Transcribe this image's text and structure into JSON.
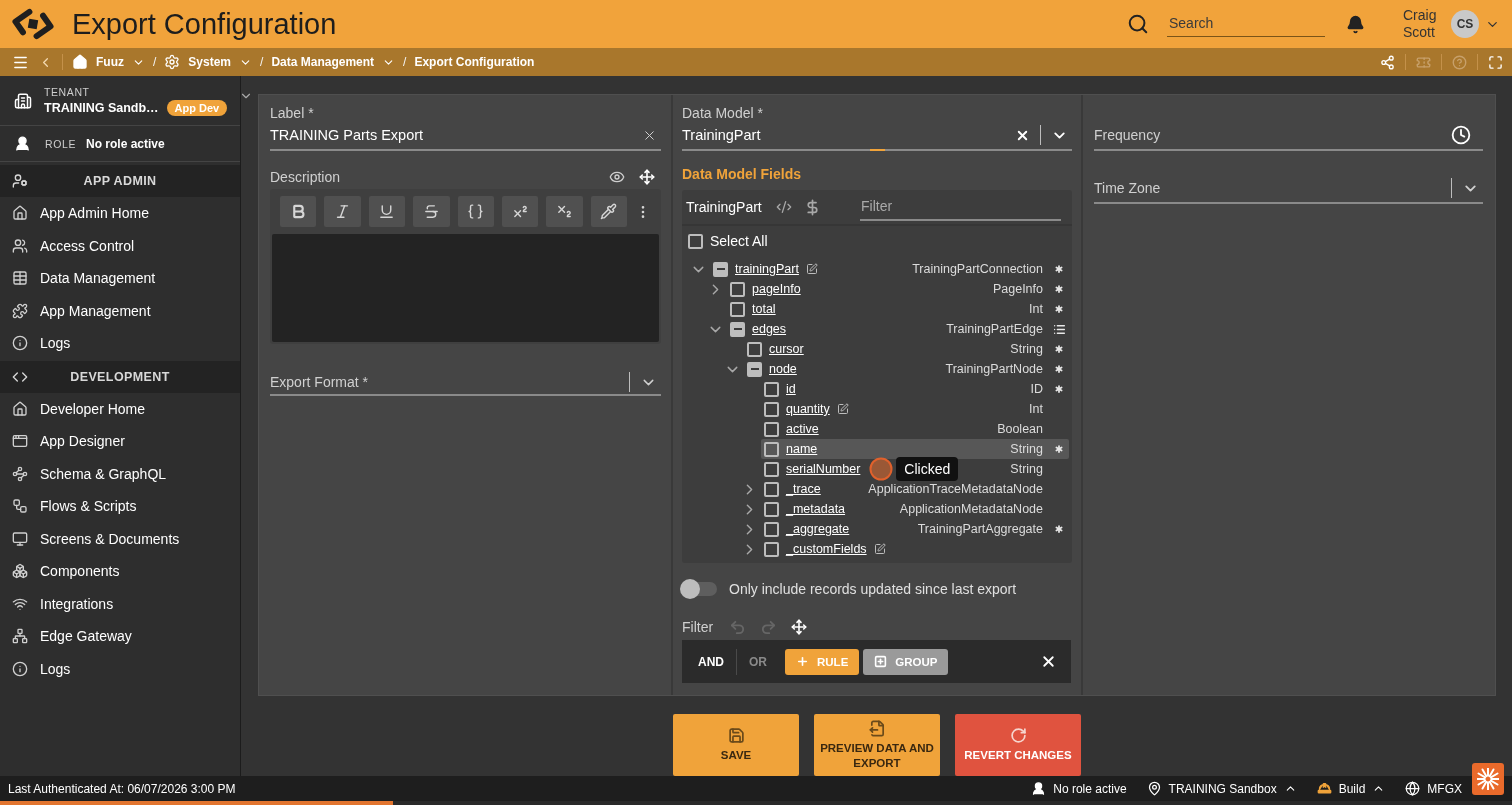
{
  "header": {
    "title": "Export Configuration",
    "search": {
      "placeholder": "Search"
    },
    "user": {
      "name": "Craig Scott",
      "initials": "CS"
    }
  },
  "breadcrumbs": [
    {
      "kind": "crumb",
      "label": "Fuuz",
      "dropdown": true
    },
    {
      "kind": "separator",
      "label": "/"
    },
    {
      "kind": "crumb",
      "label": "System",
      "dropdown": true
    },
    {
      "kind": "separator",
      "label": "/"
    },
    {
      "kind": "crumb",
      "label": "Data Management",
      "dropdown": true
    },
    {
      "kind": "separator",
      "label": "/"
    },
    {
      "kind": "crumb",
      "label": "Export Configuration",
      "dropdown": false
    }
  ],
  "page_actions": [
    {
      "disabled": false
    },
    {
      "disabled": true
    },
    {
      "disabled": true
    },
    {
      "disabled": false
    }
  ],
  "sidebar": {
    "tenant": {
      "label": "TENANT",
      "name": "TRAINING Sandb…",
      "badge": "App Dev"
    },
    "role": {
      "label": "ROLE",
      "value": "No role active"
    },
    "sections": [
      {
        "title": "APP ADMIN",
        "items": [
          {
            "label": "App Admin Home",
            "selected": false
          },
          {
            "label": "Access Control",
            "selected": false
          },
          {
            "label": "Data Management",
            "selected": false
          },
          {
            "label": "App Management",
            "selected": false
          },
          {
            "label": "Logs",
            "selected": false
          }
        ]
      },
      {
        "title": "DEVELOPMENT",
        "items": [
          {
            "label": "Developer Home",
            "selected": false
          },
          {
            "label": "App Designer",
            "selected": false
          },
          {
            "label": "Schema & GraphQL",
            "selected": false
          },
          {
            "label": "Flows & Scripts",
            "selected": false
          },
          {
            "label": "Screens & Documents",
            "selected": false
          },
          {
            "label": "Components",
            "selected": false
          },
          {
            "label": "Integrations",
            "selected": false
          },
          {
            "label": "Edge Gateway",
            "selected": false
          },
          {
            "label": "Logs",
            "selected": false
          }
        ]
      }
    ]
  },
  "label_field": {
    "label": "Label *",
    "value": "TRAINING Parts Export"
  },
  "description": {
    "label": "Description"
  },
  "export_format": {
    "label": "Export Format *"
  },
  "data_model": {
    "label": "Data Model *",
    "value": "TrainingPart"
  },
  "data_model_fields": {
    "title": "Data Model Fields",
    "model": "TrainingPart",
    "filter": {
      "placeholder": "Filter"
    },
    "select_all": {
      "label": "Select All",
      "checked": false
    },
    "tree": [
      {
        "name": "trainingPart",
        "type": "TrainingPartConnection",
        "checked": false,
        "indeterminate": true,
        "expanded": true,
        "editable": true,
        "highlighted": false,
        "required": true,
        "list": false,
        "children": [
          {
            "name": "pageInfo",
            "type": "PageInfo",
            "checked": false,
            "indeterminate": false,
            "expanded": false,
            "editable": false,
            "highlighted": false,
            "required": true,
            "list": false
          },
          {
            "name": "total",
            "type": "Int",
            "checked": false,
            "indeterminate": false,
            "editable": false,
            "highlighted": false,
            "required": true,
            "list": false
          },
          {
            "name": "edges",
            "type": "TrainingPartEdge",
            "checked": false,
            "indeterminate": true,
            "expanded": true,
            "editable": false,
            "highlighted": false,
            "required": false,
            "list": true,
            "children": [
              {
                "name": "cursor",
                "type": "String",
                "checked": false,
                "indeterminate": false,
                "editable": false,
                "highlighted": false,
                "required": true,
                "list": false
              },
              {
                "name": "node",
                "type": "TrainingPartNode",
                "checked": false,
                "indeterminate": true,
                "expanded": true,
                "editable": false,
                "highlighted": false,
                "required": true,
                "list": false,
                "children": [
                  {
                    "name": "id",
                    "type": "ID",
                    "checked": false,
                    "indeterminate": false,
                    "editable": false,
                    "highlighted": false,
                    "required": true,
                    "list": false
                  },
                  {
                    "name": "quantity",
                    "type": "Int",
                    "checked": false,
                    "indeterminate": false,
                    "editable": true,
                    "highlighted": false,
                    "required": false,
                    "list": false
                  },
                  {
                    "name": "active",
                    "type": "Boolean",
                    "checked": false,
                    "indeterminate": false,
                    "editable": false,
                    "highlighted": false,
                    "required": false,
                    "list": false
                  },
                  {
                    "name": "name",
                    "type": "String",
                    "checked": false,
                    "indeterminate": false,
                    "editable": false,
                    "highlighted": true,
                    "required": true,
                    "list": false
                  },
                  {
                    "name": "serialNumber",
                    "type": "String",
                    "checked": false,
                    "indeterminate": false,
                    "editable": false,
                    "highlighted": false,
                    "required": false,
                    "list": false,
                    "tooltip": "Clicked"
                  },
                  {
                    "name": "_trace",
                    "type": "ApplicationTraceMetadataNode",
                    "checked": false,
                    "indeterminate": false,
                    "expanded": false,
                    "editable": false,
                    "highlighted": false,
                    "required": false,
                    "list": false
                  },
                  {
                    "name": "_metadata",
                    "type": "ApplicationMetadataNode",
                    "checked": false,
                    "indeterminate": false,
                    "expanded": false,
                    "editable": false,
                    "highlighted": false,
                    "required": false,
                    "list": false
                  },
                  {
                    "name": "_aggregate",
                    "type": "TrainingPartAggregate",
                    "checked": false,
                    "indeterminate": false,
                    "expanded": false,
                    "editable": false,
                    "highlighted": false,
                    "required": true,
                    "list": false
                  },
                  {
                    "name": "_customFields",
                    "checked": false,
                    "indeterminate": false,
                    "expanded": false,
                    "editable": true,
                    "highlighted": false
                  }
                ]
              }
            ]
          }
        ]
      }
    ]
  },
  "incremental_toggle": {
    "label": "Only include records updated since last export",
    "on": false
  },
  "filter": {
    "label": "Filter",
    "undo": {
      "disabled": true
    },
    "redo": {
      "disabled": true
    },
    "combinators": [
      {
        "label": "AND",
        "selected": true
      },
      {
        "label": "OR",
        "selected": false
      }
    ],
    "buttons": [
      {
        "kind": "rule",
        "label": "RULE"
      },
      {
        "kind": "group",
        "label": "GROUP"
      }
    ]
  },
  "frequency": {
    "label": "Frequency"
  },
  "time_zone": {
    "label": "Time Zone"
  },
  "actions": [
    {
      "kind": "save",
      "label": "SAVE"
    },
    {
      "kind": "preview",
      "label": "PREVIEW DATA AND EXPORT"
    },
    {
      "kind": "revert",
      "label": "REVERT CHANGES"
    }
  ],
  "status_bar": {
    "text": "Last Authenticated At: 06/07/2026 3:00 PM",
    "items": [
      {
        "label": "No role active",
        "menu": false
      },
      {
        "label": "TRAINING Sandbox",
        "menu": true
      },
      {
        "label": "Build",
        "menu": true
      },
      {
        "label": "MFGX",
        "menu": false
      }
    ],
    "progress": {
      "level": 0.26
    }
  }
}
